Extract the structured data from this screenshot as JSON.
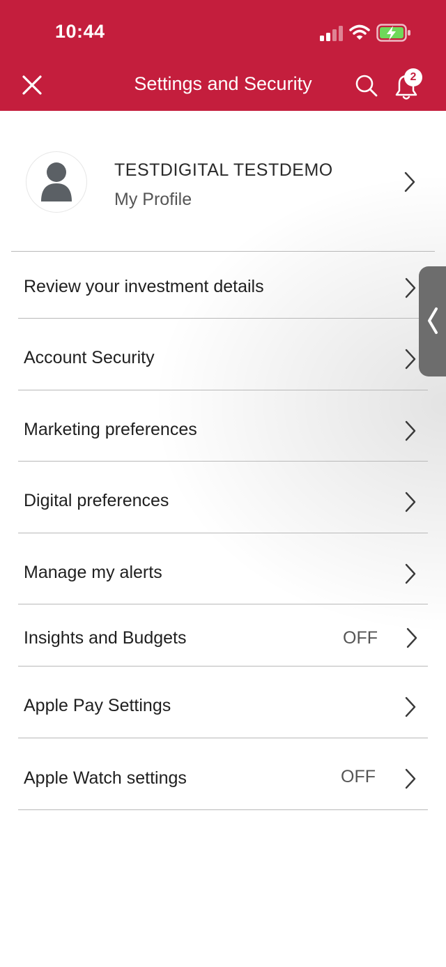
{
  "status_bar": {
    "time": "10:44",
    "signal_icon": "cellular-signal-icon",
    "wifi_icon": "wifi-icon",
    "battery_icon": "battery-charging-icon"
  },
  "header": {
    "title": "Settings and Security",
    "close_icon": "close-icon",
    "search_icon": "search-icon",
    "bell_icon": "bell-icon",
    "notification_count": "2",
    "background_color": "#c41e3d"
  },
  "profile": {
    "name": "TESTDIGITAL TESTDEMO",
    "subtitle": "My Profile",
    "avatar_icon": "person-avatar-icon"
  },
  "menu": {
    "items": [
      {
        "label": "Review your investment details",
        "status": ""
      },
      {
        "label": "Account Security",
        "status": ""
      },
      {
        "label": "Marketing preferences",
        "status": ""
      },
      {
        "label": "Digital preferences",
        "status": ""
      },
      {
        "label": "Manage my alerts",
        "status": ""
      },
      {
        "label": "Insights and Budgets",
        "status": "OFF"
      },
      {
        "label": "Apple Pay Settings",
        "status": ""
      },
      {
        "label": "Apple Watch settings",
        "status": "OFF"
      }
    ]
  },
  "side_tab": {
    "icon": "chevron-left-icon"
  }
}
